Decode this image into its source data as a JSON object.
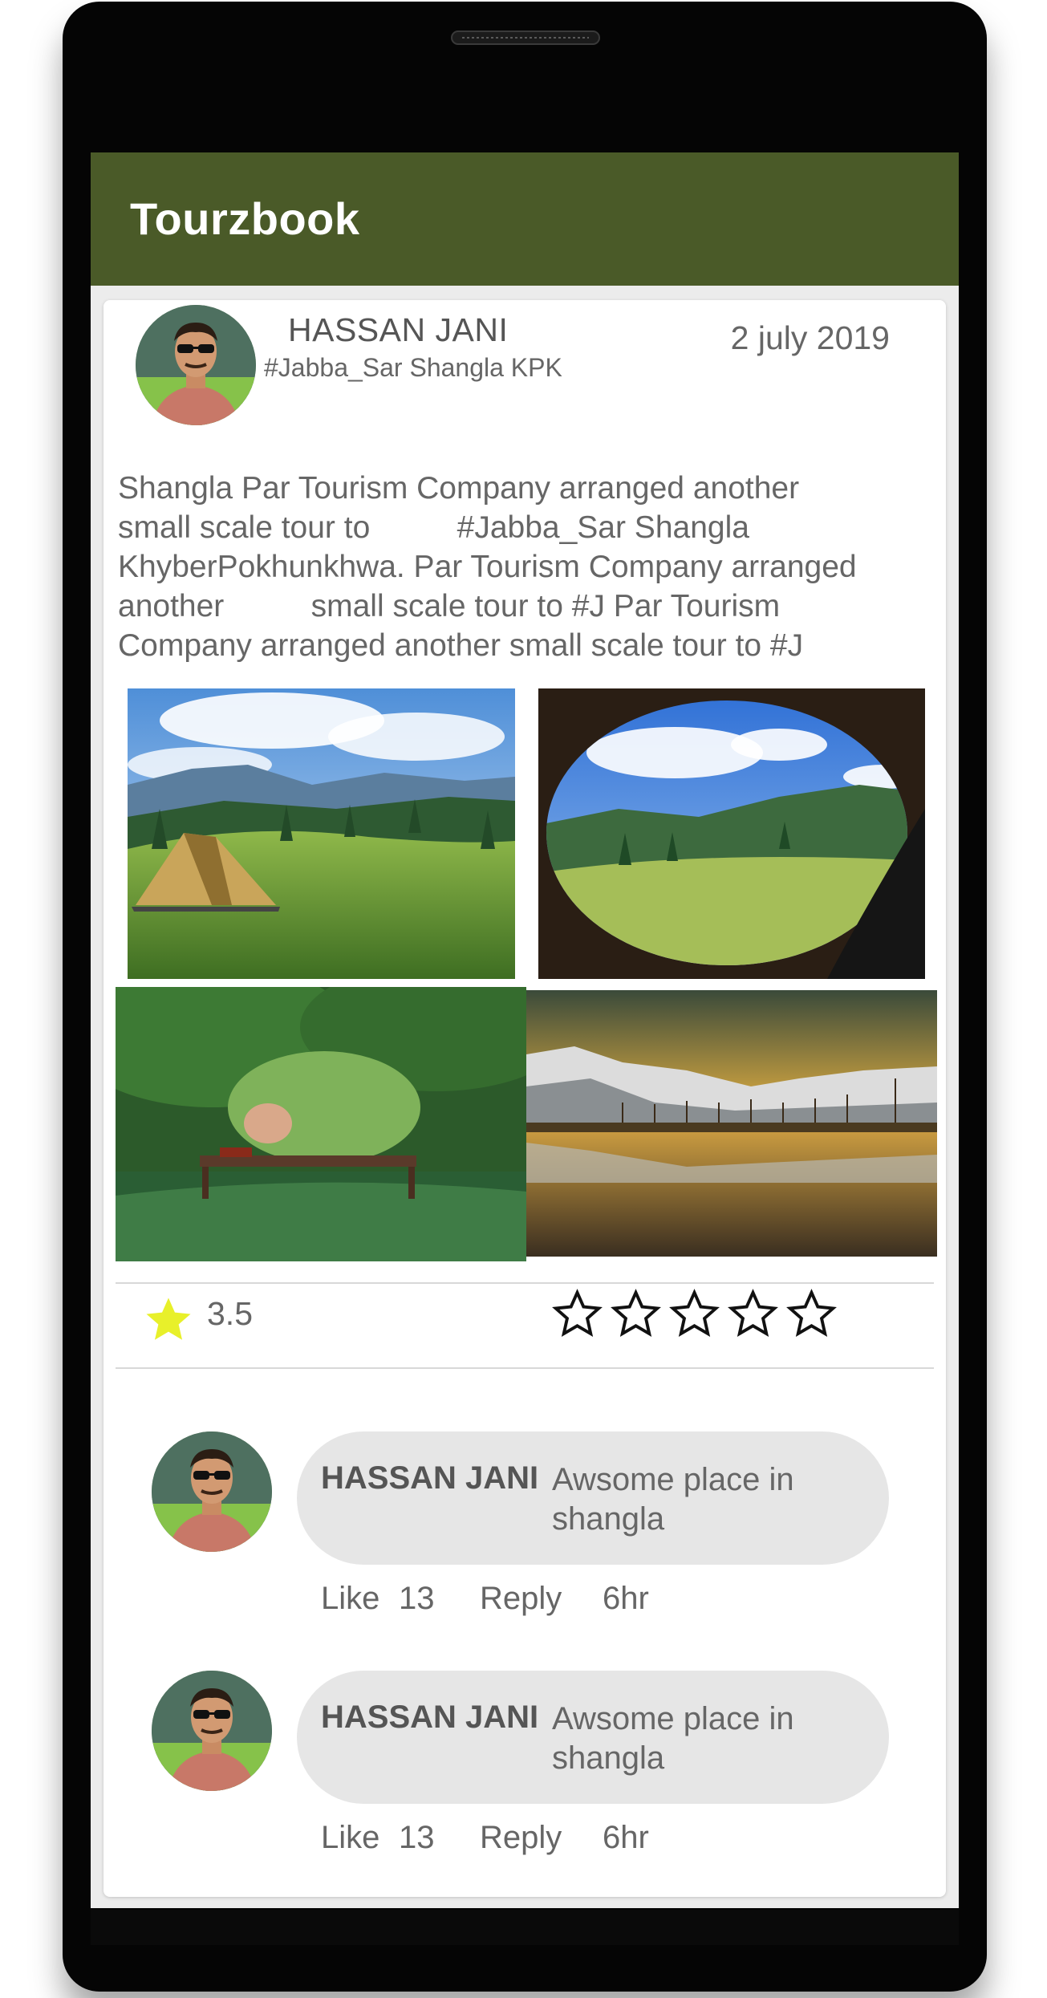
{
  "app": {
    "title": "Tourzbook"
  },
  "post": {
    "author": "HASSAN JANI",
    "location": "#Jabba_Sar Shangla KPK",
    "date": "2 july 2019",
    "text_lines": [
      "Shangla Par Tourism Company arranged another",
      "small scale tour to          #Jabba_Sar Shangla",
      "KhyberPokhunkhwa. Par Tourism Company arranged",
      "another          small scale tour to #J Par Tourism",
      "Company arranged another small scale tour to #J"
    ],
    "photos": [
      "tent-meadow-photo",
      "window-valley-photo",
      "forest-bench-photo",
      "mountain-lake-photo"
    ],
    "rating": {
      "value": "3.5",
      "max_stars": 5,
      "user_rating": 0
    }
  },
  "comments": [
    {
      "author": "HASSAN JANI",
      "text": "Awsome place in shangla",
      "like_label": "Like",
      "likes": "13",
      "reply_label": "Reply",
      "time": "6hr"
    },
    {
      "author": "HASSAN JANI",
      "text": "Awsome place in shangla",
      "like_label": "Like",
      "likes": "13",
      "reply_label": "Reply",
      "time": "6hr"
    }
  ],
  "colors": {
    "appbar": "#4a5a28",
    "star_filled": "#e8f02a",
    "bubble": "#e6e6e6"
  }
}
